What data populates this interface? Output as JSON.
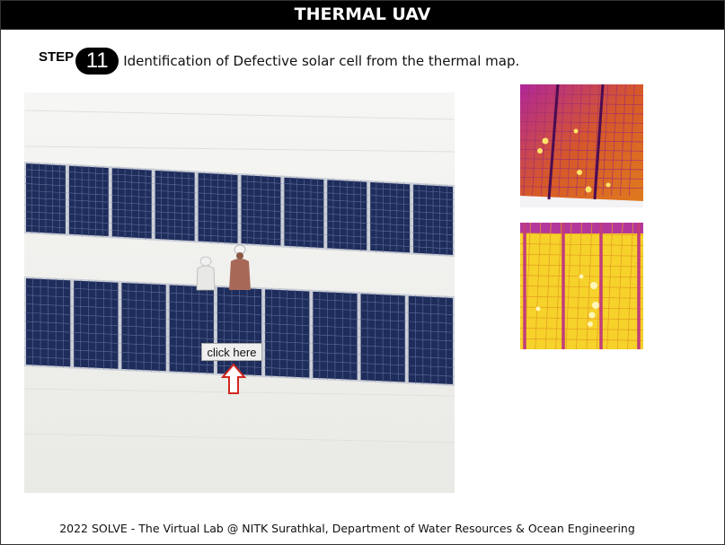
{
  "header": {
    "title": "THERMAL UAV"
  },
  "step": {
    "label": "STEP",
    "number": "11",
    "description": "Identification of Defective solar cell from the thermal map."
  },
  "scene": {
    "button_label": "click here",
    "arrow_icon": "up-arrow-outline-icon",
    "arrow_color": "#d0271f",
    "panel_color": "#1f2d5c"
  },
  "thermal_images": [
    {
      "name": "thermal-map-iron-palette"
    },
    {
      "name": "thermal-map-yellow-palette"
    }
  ],
  "footer": {
    "text": "2022 SOLVE - The Virtual Lab @ NITK Surathkal, Department of Water Resources & Ocean Engineering"
  }
}
